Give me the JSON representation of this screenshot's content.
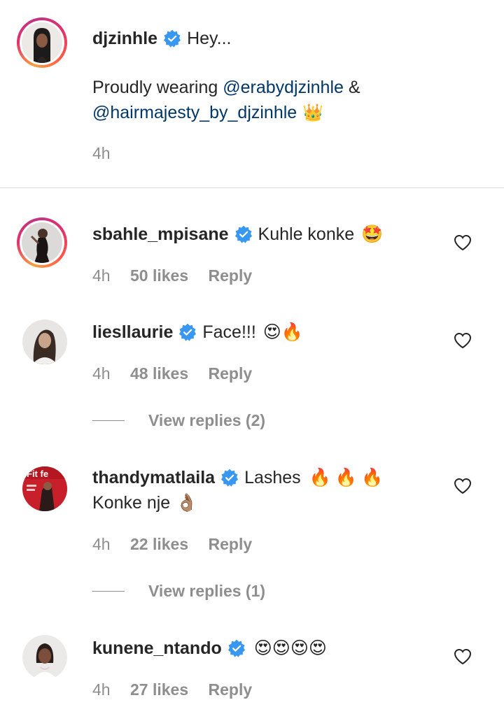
{
  "caption": {
    "username": "djzinhle",
    "lead_text": "Hey...",
    "line1_prefix": "Proudly wearing ",
    "mention1": "@erabydjzinhle",
    "line1_suffix": " &",
    "mention2": "@hairmajesty_by_djzinhle",
    "crown_emoji": "👑",
    "time": "4h"
  },
  "comments": [
    {
      "username": "sbahle_mpisane",
      "text": "Kuhle konke",
      "emoji": "🤩",
      "time": "4h",
      "likes": "50 likes",
      "reply_label": "Reply"
    },
    {
      "username": "liesllaurie",
      "text": "Face!!!",
      "emoji": "😍🔥",
      "time": "4h",
      "likes": "48 likes",
      "reply_label": "Reply",
      "view_replies": "View replies (2)"
    },
    {
      "username": "thandymatlaila",
      "text": "Lashes",
      "emoji": "🔥🔥🔥",
      "text2": "Konke nje",
      "emoji2": "👌🏽",
      "time": "4h",
      "likes": "22 likes",
      "reply_label": "Reply",
      "view_replies": "View replies (1)",
      "avatar_label": "Fit fe"
    },
    {
      "username": "kunene_ntando",
      "text": "",
      "emoji": "😍😍😍😍",
      "time": "4h",
      "likes": "27 likes",
      "reply_label": "Reply"
    }
  ],
  "colors": {
    "verified": "#3897f0",
    "mention": "#00376b",
    "meta": "#8e8e8e"
  },
  "icons": [
    "verified-badge-icon",
    "heart-outline-icon"
  ]
}
